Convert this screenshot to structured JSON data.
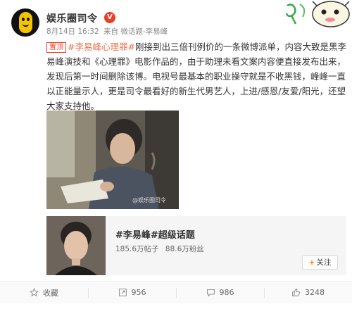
{
  "header": {
    "author": "娱乐圈司令",
    "verified_mark": "V",
    "date": "8月14日 16:32",
    "source": "来自 微话题-李易峰"
  },
  "post": {
    "pin_label": "置顶",
    "hashtag": "#李易峰心理罪#",
    "text_1": "刚接到出三倍刊例价的一条微博派单，内容大致是黑李易峰演技和《心理罪》电影作品的，由于助理未看文案内容便直接发布出来，发现后第一时间删除该博。电视号最基本的职业操守就是不收黑钱，峰峰一直以正能量示人，更是司令最看好的新生代男艺人，上进/感恩/友爱/阳光，还望大家支持他。",
    "image_caption": "@娱乐圈司令"
  },
  "topic_card": {
    "title": "#李易峰#超级话题",
    "posts": "185.6万帖子",
    "fans": "88.6万粉丝",
    "follow_label": "关注"
  },
  "actions": {
    "favorite_label": "收藏",
    "repost_count": "956",
    "comment_count": "986",
    "like_count": "3248"
  },
  "icons": [
    "star-icon",
    "repost-icon",
    "comment-icon",
    "like-icon",
    "plus-icon",
    "verified-icon"
  ],
  "colors": {
    "accent": "#eb7350",
    "verified": "#e83f2a",
    "follow_plus": "#ff8200"
  }
}
